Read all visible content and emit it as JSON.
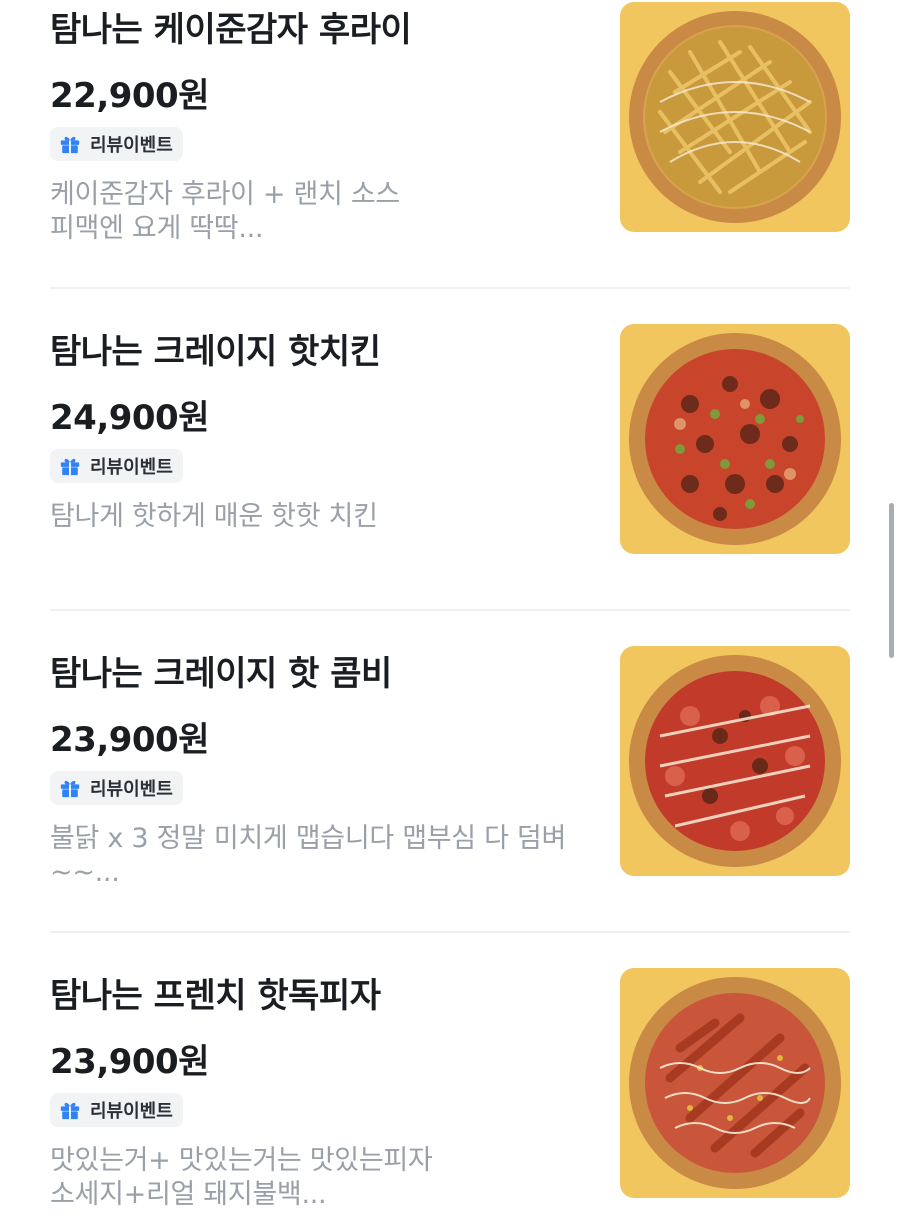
{
  "menu": {
    "items": [
      {
        "name": "탐나는 케이준감자 후라이",
        "price": "22,900원",
        "badge": "리뷰이벤트",
        "desc_lines": [
          "케이준감자 후라이 + 랜치 소스",
          "피맥엔 요게 딱딱..."
        ],
        "image_icon": "pizza-fries-image"
      },
      {
        "name": "탐나는 크레이지 핫치킨",
        "price": "24,900원",
        "badge": "리뷰이벤트",
        "desc_lines": [
          "탐나게 핫하게 매운  핫핫 치킨"
        ],
        "image_icon": "pizza-hot-chicken-image"
      },
      {
        "name": "탐나는 크레이지 핫 콤비",
        "price": "23,900원",
        "badge": "리뷰이벤트",
        "desc_lines": [
          "불닭 x 3 정말 미치게 맵습니다 맵부심 다 덤벼",
          "~~..."
        ],
        "image_icon": "pizza-hot-combi-image"
      },
      {
        "name": "탐나는 프렌치 핫독피자",
        "price": "23,900원",
        "badge": "리뷰이벤트",
        "desc_lines": [
          "맛있는거+ 맛있는거는 맛있는피자",
          "소세지+리얼 돼지불백..."
        ],
        "image_icon": "pizza-hotdog-image"
      }
    ]
  },
  "colors": {
    "title": "#1a1d21",
    "description": "#9aa0a8",
    "badge_bg": "#f1f3f5",
    "gift_icon": "#3182f6",
    "image_bg": "#f2c65e"
  }
}
